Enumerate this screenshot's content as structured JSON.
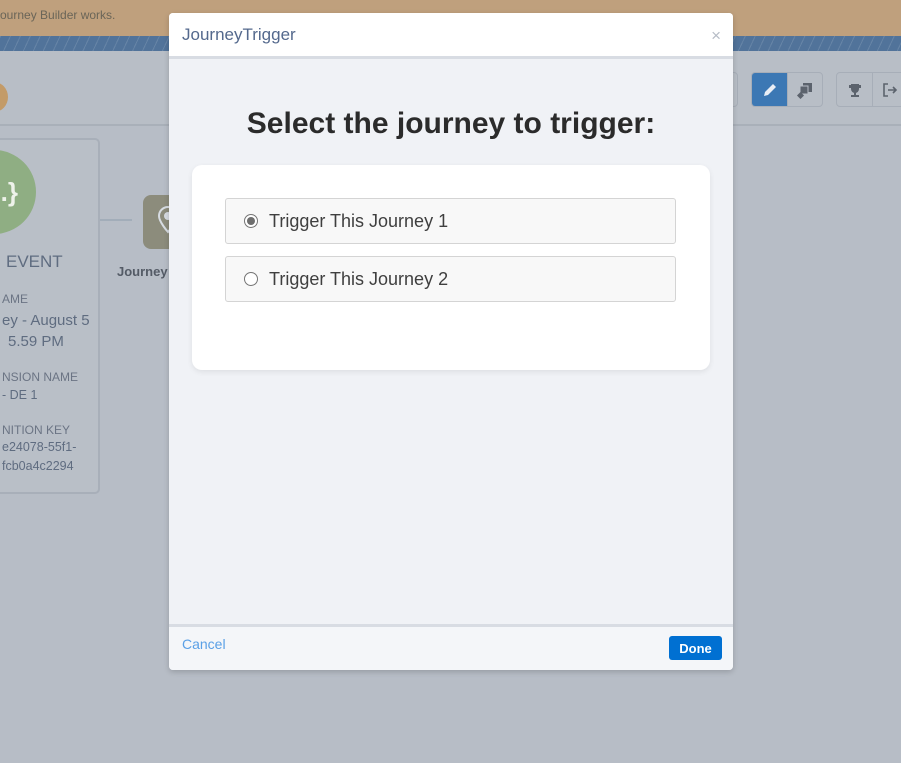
{
  "background": {
    "banner_text": "ourney Builder works.",
    "toolbar": {
      "buttons": [
        {
          "name": "edit",
          "icon": "pencil-icon",
          "active": true
        },
        {
          "name": "copy",
          "icon": "copy-icon",
          "active": false
        },
        {
          "name": "goals",
          "icon": "trophy-icon",
          "active": false
        },
        {
          "name": "exit",
          "icon": "exit-icon",
          "active": false
        }
      ]
    },
    "event_card": {
      "icon_glyph": "..}",
      "title": "EVENT",
      "fields": [
        {
          "label": "AME",
          "value_lines": [
            "ey - August 5",
            "5.59 PM"
          ]
        },
        {
          "label": "NSION NAME",
          "value_lines": [
            "DE 1"
          ]
        },
        {
          "label": "NITION KEY",
          "value_lines": [
            "e24078-55f1-",
            "fcb0a4c2294"
          ]
        }
      ]
    },
    "node": {
      "label": "Journey"
    }
  },
  "modal": {
    "title": "JourneyTrigger",
    "close_glyph": "×",
    "prompt": "Select the journey to trigger:",
    "options": [
      {
        "label": "Trigger This Journey 1",
        "selected": true
      },
      {
        "label": "Trigger This Journey 2",
        "selected": false
      }
    ],
    "footer": {
      "cancel_label": "Cancel",
      "done_label": "Done"
    }
  }
}
